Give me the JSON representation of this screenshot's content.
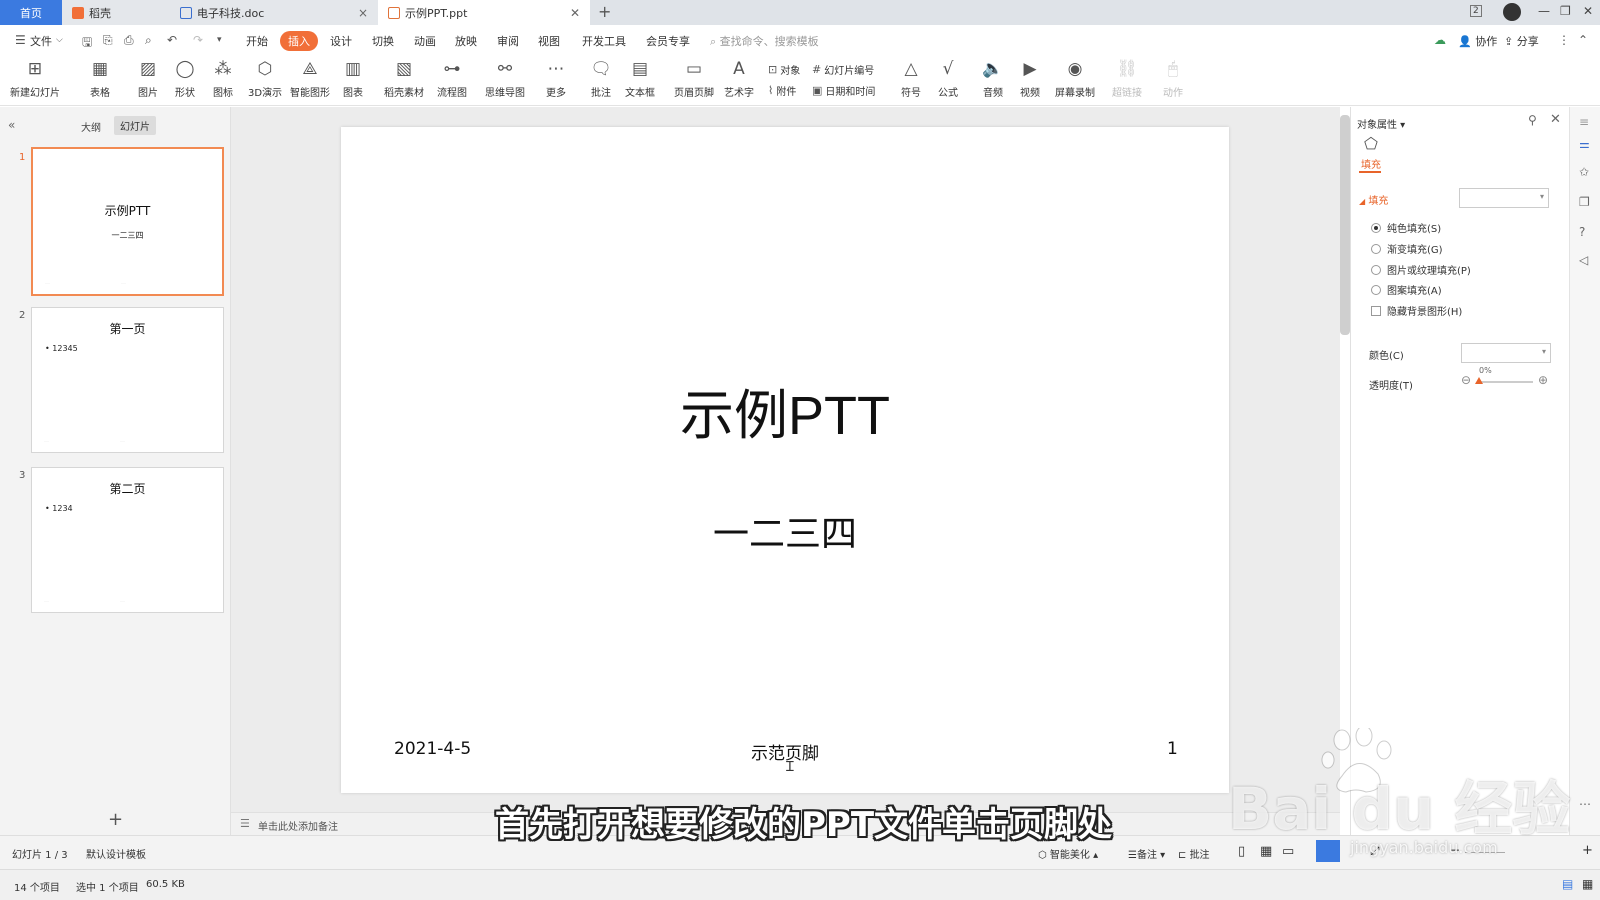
{
  "titlebar": {
    "tabs": [
      {
        "label": "首页"
      },
      {
        "label": "稻壳"
      },
      {
        "label": "电子科技.doc"
      },
      {
        "label": "示例PPT.ppt"
      }
    ],
    "badge": "2"
  },
  "menubar": {
    "file": "文件",
    "items": [
      "开始",
      "插入",
      "设计",
      "切换",
      "动画",
      "放映",
      "审阅",
      "视图",
      "开发工具",
      "会员专享"
    ],
    "active": "插入",
    "search_placeholder": "查找命令、搜索模板",
    "collab": "协作",
    "share": "分享"
  },
  "ribbon": {
    "new_slide": "新建幻灯片",
    "table": "表格",
    "picture": "图片",
    "shape": "形状",
    "icon": "图标",
    "demo3d": "3D演示",
    "smart_shape": "智能图形",
    "chart": "图表",
    "daoke": "稻壳素材",
    "flow": "流程图",
    "mindmap": "思维导图",
    "more": "更多",
    "comment": "批注",
    "textbox": "文本框",
    "header_footer": "页眉页脚",
    "wordart": "艺术字",
    "object": "对象",
    "attach": "附件",
    "slide_number": "幻灯片编号",
    "datetime": "日期和时间",
    "symbol": "符号",
    "formula": "公式",
    "audio": "音频",
    "video": "视频",
    "screen_rec": "屏幕录制",
    "hyperlink": "超链接",
    "action": "动作"
  },
  "leftpanel": {
    "tab_outline": "大纲",
    "tab_slides": "幻灯片",
    "slides": [
      {
        "num": "1",
        "title": "示例PTT",
        "sub": "一二三四"
      },
      {
        "num": "2",
        "title": "第一页",
        "bullet": "• 12345"
      },
      {
        "num": "3",
        "title": "第二页",
        "bullet": "• 1234"
      }
    ],
    "add": "+"
  },
  "slide": {
    "title": "示例PTT",
    "subtitle": "一二三四",
    "footer_date": "2021-4-5",
    "footer_text": "示范页脚",
    "footer_num": "1"
  },
  "notes_placeholder": "单击此处添加备注",
  "rightpanel": {
    "header": "对象属性",
    "tab_fill": "填充",
    "section_fill": "填充",
    "options": [
      "纯色填充(S)",
      "渐变填充(G)",
      "图片或纹理填充(P)",
      "图案填充(A)"
    ],
    "checkbox": "隐藏背景图形(H)",
    "color_label": "颜色(C)",
    "transparency_label": "透明度(T)",
    "transparency_value": "0%"
  },
  "statusbar": {
    "slide_info": "幻灯片 1 / 3",
    "template": "默认设计模板",
    "beautify": "智能美化",
    "notes": "备注",
    "comments": "批注"
  },
  "bottombar": {
    "items": "14 个项目",
    "selected": "选中 1 个项目",
    "size": "60.5 KB"
  },
  "overlay": {
    "subtitle": "首先打开想要修改的PPT文件单击页脚处",
    "watermark": "Bai du 经验",
    "watermark_url": "jingyan.baidu.com"
  },
  "colors": {
    "accent": "#f16f38",
    "home_tab": "#3b7ae0"
  }
}
